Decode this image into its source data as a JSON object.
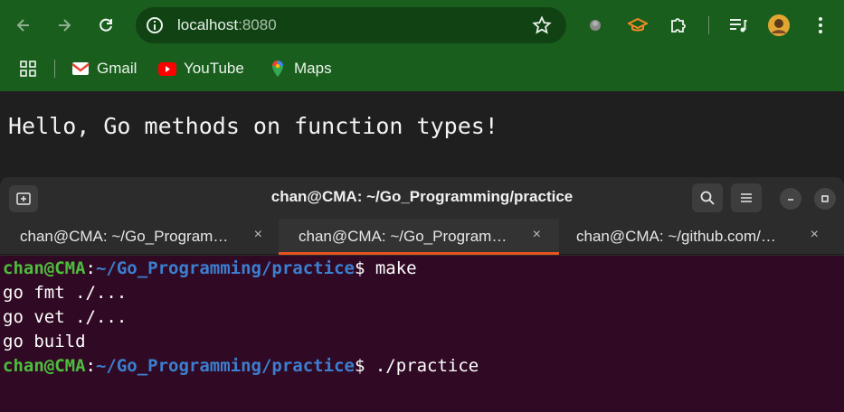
{
  "browser": {
    "url_host": "localhost",
    "url_port": ":8080",
    "icons": [
      "back-icon",
      "forward-icon",
      "reload-icon",
      "site-info-icon",
      "bookmark-star-icon",
      "extension-dot-icon",
      "graduation-cap-icon",
      "puzzle-icon",
      "media-queue-icon",
      "profile-avatar",
      "kebab-menu-icon"
    ],
    "bookmarks": [
      {
        "label": "Gmail",
        "icon": "gmail-icon"
      },
      {
        "label": "YouTube",
        "icon": "youtube-icon"
      },
      {
        "label": "Maps",
        "icon": "maps-icon"
      }
    ],
    "colors": {
      "chrome_green": "#1a5e1e",
      "omnibox": "#114214"
    }
  },
  "page": {
    "text": "Hello, Go methods on function types!"
  },
  "terminal": {
    "title": "chan@CMA: ~/Go_Programming/practice",
    "tabs": [
      {
        "label": "chan@CMA: ~/Go_Program…",
        "active": false
      },
      {
        "label": "chan@CMA: ~/Go_Program…",
        "active": true
      },
      {
        "label": "chan@CMA: ~/github.com/…",
        "active": false
      }
    ],
    "tab_close": "×",
    "prompt_user": "chan@CMA",
    "prompt_colon": ":",
    "prompt_path": "~/Go_Programming/practice",
    "prompt_dollar": "$",
    "lines": [
      {
        "type": "prompt",
        "cmd": " make"
      },
      {
        "type": "output",
        "text": "go fmt ./..."
      },
      {
        "type": "output",
        "text": "go vet ./..."
      },
      {
        "type": "output",
        "text": "go build"
      },
      {
        "type": "prompt",
        "cmd": " ./practice"
      }
    ],
    "colors": {
      "background": "#300a24",
      "user": "#4ebd3d",
      "path": "#3b7fd0",
      "accent": "#e95420"
    }
  }
}
